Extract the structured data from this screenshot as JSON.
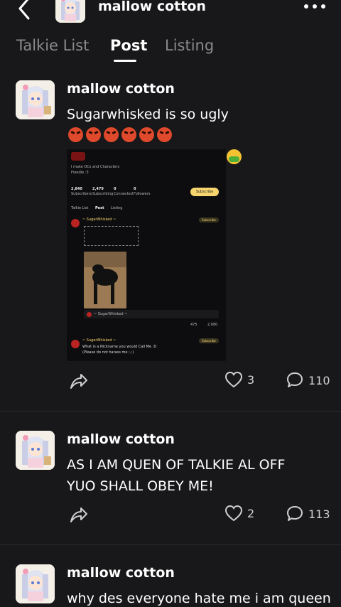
{
  "header": {
    "title": "mallow cotton"
  },
  "tabs": [
    {
      "label": "Talkie List"
    },
    {
      "label": "Post"
    },
    {
      "label": "Listing"
    }
  ],
  "posts": [
    {
      "author": "mallow cotton",
      "text": "Sugarwhisked is so ugly",
      "likes": "3",
      "comments": "110",
      "embedded_screenshot": {
        "bio_line": "I make OCs and Characters",
        "bio_line2": "Freedle :3",
        "stats": [
          {
            "value": "2,840",
            "label": "Subscribers"
          },
          {
            "value": "2,479",
            "label": "Subscribing"
          },
          {
            "value": "0",
            "label": "Connected"
          },
          {
            "value": "0",
            "label": "Followers"
          }
        ],
        "subscribe_label": "Subscribe",
        "tabs": [
          "Talkie List",
          "Post",
          "Listing"
        ],
        "post_author": "~ SugarWhisked ~",
        "post2_author": "~ SugarWhisked ~",
        "post2_line1": "What is a Nickname you would Call Me :D",
        "post2_line2": "(Please do not harass me ;-;)",
        "small_likes": "475",
        "small_comments": "2,080"
      }
    },
    {
      "author": "mallow cotton",
      "text": "AS I AM QUEN OF TALKIE AL OFF YUO SHALL OBEY ME!",
      "likes": "2",
      "comments": "113"
    },
    {
      "author": "mallow cotton",
      "text": "why des everyone hate me i am queen"
    }
  ],
  "icons": {
    "back": "chevron-left-icon",
    "more": "more-dots-icon",
    "share": "share-icon",
    "like": "heart-icon",
    "comment": "comment-icon"
  },
  "colors": {
    "background": "#18181a",
    "text": "#f2f2f2",
    "muted": "#8a8a8e",
    "subscribe": "#f6d46e"
  }
}
